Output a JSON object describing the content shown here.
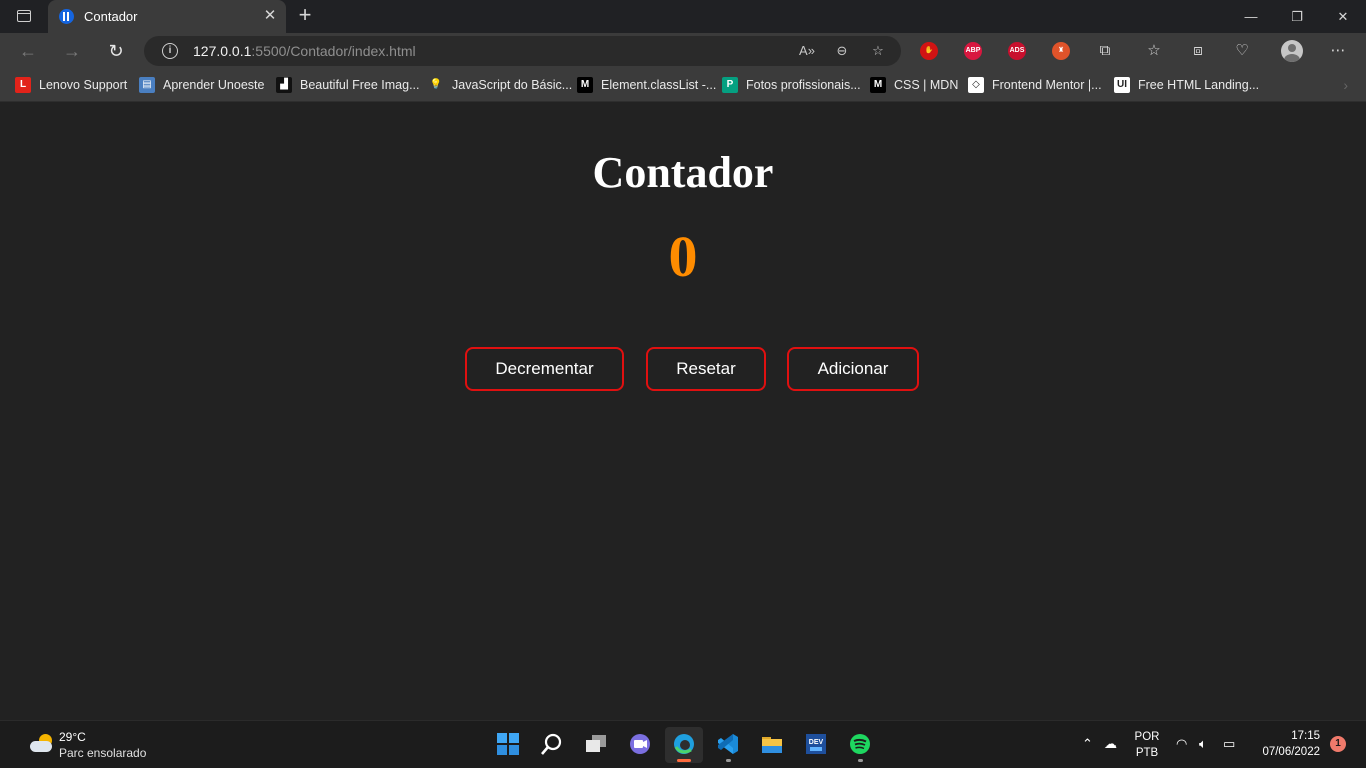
{
  "browser": {
    "tab": {
      "title": "Contador",
      "close": "✕"
    },
    "new_tab": "+",
    "window_controls": {
      "minimize": "—",
      "maximize": "❐",
      "close": "✕"
    },
    "url": {
      "host": "127.0.0.1",
      "rest": ":5500/Contador/index.html"
    },
    "extensions": [
      {
        "name": "block-extension",
        "label": "✋",
        "color": "#d11313"
      },
      {
        "name": "abp-extension",
        "label": "ABP",
        "color": "#d8173f"
      },
      {
        "name": "ads-extension",
        "label": "ADS",
        "color": "#c8102e"
      },
      {
        "name": "bookmark-extension",
        "label": "♜",
        "color": "#e0532a"
      }
    ]
  },
  "bookmarks": [
    {
      "label": "Lenovo Support",
      "icon": "L",
      "color": "#e2231a"
    },
    {
      "label": "Aprender Unoeste",
      "icon": "▤",
      "color": "#4a7fc1"
    },
    {
      "label": "Beautiful Free Imag...",
      "icon": "▟",
      "color": "#111111"
    },
    {
      "label": "JavaScript do Básic...",
      "icon": "💡",
      "color": "transparent"
    },
    {
      "label": "Element.classList -...",
      "icon": "M",
      "color": "#000000"
    },
    {
      "label": "Fotos profissionais...",
      "icon": "P",
      "color": "#05a081"
    },
    {
      "label": "CSS | MDN",
      "icon": "M",
      "color": "#000000"
    },
    {
      "label": "Frontend Mentor |...",
      "icon": "◇",
      "color": "#ffffff"
    },
    {
      "label": "Free HTML Landing...",
      "icon": "UI",
      "color": "#ffffff"
    }
  ],
  "page": {
    "title": "Contador",
    "counter_value": "0",
    "buttons": {
      "decrement": "Decrementar",
      "reset": "Resetar",
      "increment": "Adicionar"
    },
    "colors": {
      "background": "#222222",
      "counter": "#ff8c00",
      "button_border": "#e01010"
    }
  },
  "taskbar": {
    "weather": {
      "temp": "29°C",
      "desc": "Parc ensolarado"
    },
    "language": {
      "line1": "POR",
      "line2": "PTB"
    },
    "clock": {
      "time": "17:15",
      "date": "07/06/2022"
    },
    "notifications": "1"
  }
}
